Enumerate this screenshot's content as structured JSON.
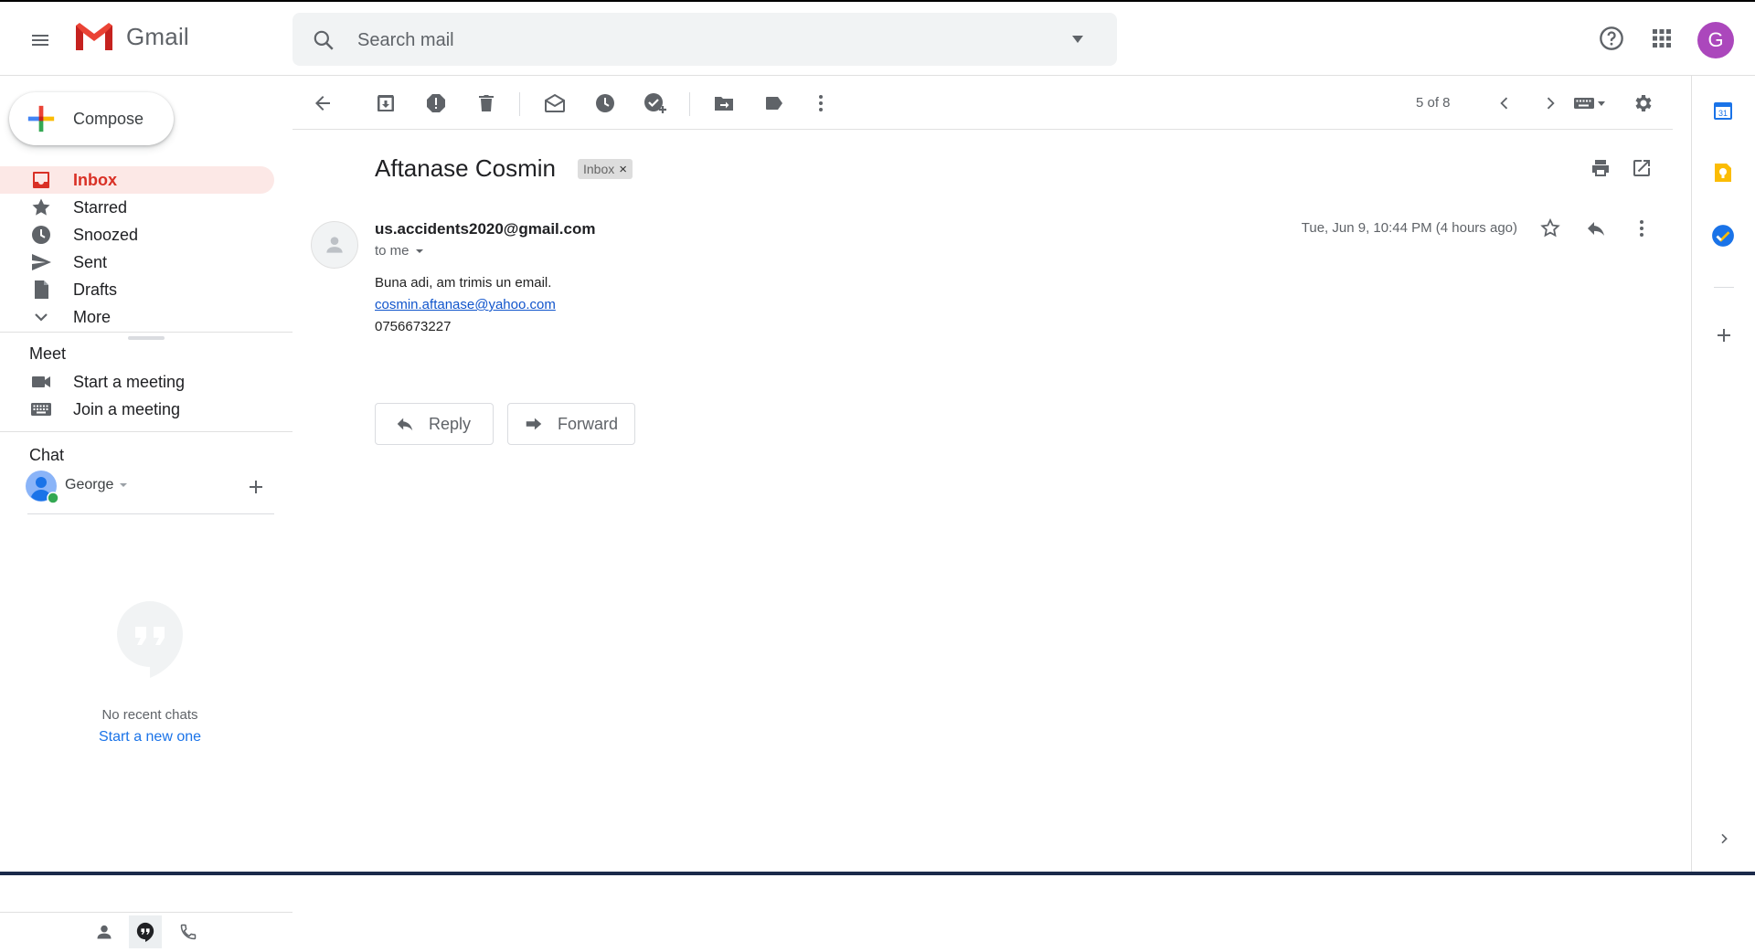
{
  "app": {
    "name": "Gmail"
  },
  "header": {
    "search_placeholder": "Search mail",
    "account_initial": "G"
  },
  "sidebar": {
    "compose_label": "Compose",
    "items": [
      {
        "label": "Inbox"
      },
      {
        "label": "Starred"
      },
      {
        "label": "Snoozed"
      },
      {
        "label": "Sent"
      },
      {
        "label": "Drafts"
      },
      {
        "label": "More"
      }
    ],
    "meet": {
      "title": "Meet",
      "start": "Start a meeting",
      "join": "Join a meeting"
    },
    "chat": {
      "title": "Chat",
      "user": "George",
      "empty_text": "No recent chats",
      "start_new": "Start a new one"
    }
  },
  "toolbar": {
    "pagination": "5 of 8"
  },
  "message": {
    "subject": "Aftanase Cosmin",
    "label": "Inbox",
    "label_remove": "×",
    "sender": "us.accidents2020@gmail.com",
    "recipient": "to me",
    "date": "Tue, Jun 9, 10:44 PM (4 hours ago)",
    "body": [
      "Buna adi, am trimis un email.",
      "cosmin.aftanase@yahoo.com",
      "0756673227"
    ],
    "reply_label": "Reply",
    "forward_label": "Forward"
  },
  "colors": {
    "accent_red": "#d93025",
    "active_bg": "#fce8e6",
    "link": "#1155cc",
    "avatar": "#ab47bc"
  }
}
